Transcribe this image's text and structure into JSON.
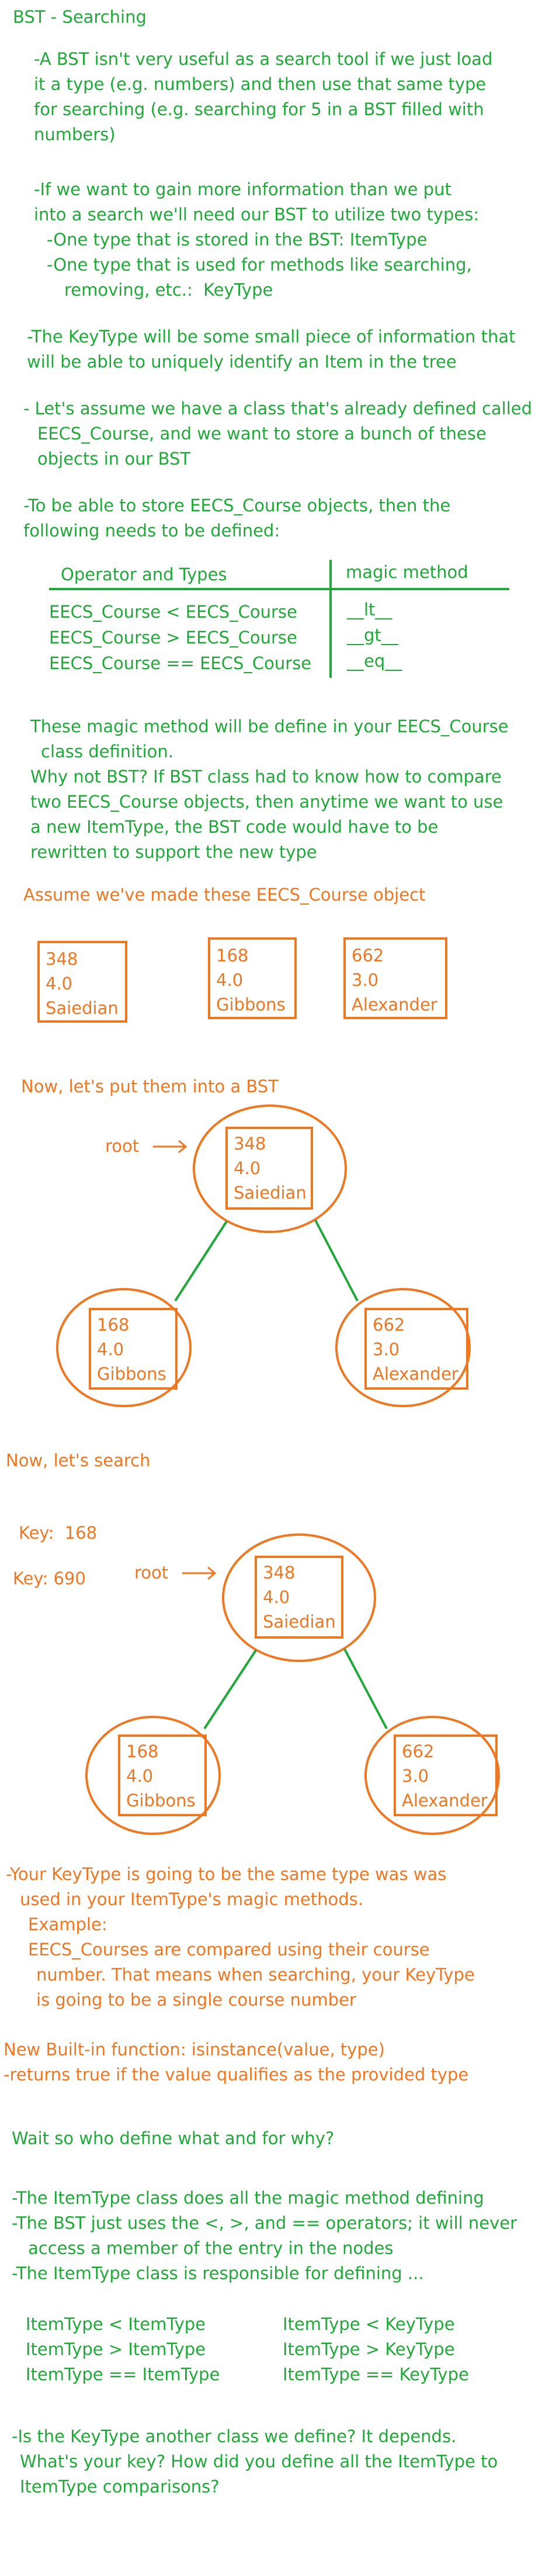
{
  "title": "BST - Searching",
  "intro": {
    "p1": [
      "-A BST isn't very useful as a search tool if we just load",
      "it a type (e.g. numbers) and then use that same type",
      "for searching (e.g. searching for 5 in a BST filled with",
      "numbers)"
    ],
    "p2": [
      "-If we want to gain more information than we put",
      "into a search we'll need our BST to utilize two types:",
      "-One type that is stored in the BST: ItemType",
      "-One type that is used for methods like searching,",
      "removing, etc.:  KeyType"
    ],
    "p3": [
      "-The KeyType will be some small piece of information that",
      "will be able to uniquely identify an Item in the tree"
    ],
    "p4": [
      "- Let's assume we have a class that's already defined called",
      "EECS_Course, and we want to store a bunch of these",
      "objects in our BST"
    ],
    "p5": [
      "-To be able to store EECS_Course objects, then the",
      "following needs to be defined:"
    ]
  },
  "table": {
    "header_left": "Operator and Types",
    "header_right": "magic method",
    "rows": [
      {
        "op": "EECS_Course < EECS_Course",
        "magic": "__lt__"
      },
      {
        "op": "EECS_Course > EECS_Course",
        "magic": "__gt__"
      },
      {
        "op": "EECS_Course == EECS_Course",
        "magic": "__eq__"
      }
    ]
  },
  "magic_note": [
    "These magic method will be define in your EECS_Course",
    "class definition.",
    "Why not BST? If BST class had to know how to compare",
    "two EECS_Course objects, then anytime we want to use",
    "a new ItemType, the BST code would have to be",
    "rewritten to support the new type"
  ],
  "objects_heading": "Assume we've made these EECS_Course object",
  "courses": [
    {
      "number": "348",
      "rating": "4.0",
      "name": "Saiedian"
    },
    {
      "number": "168",
      "rating": "4.0",
      "name": "Gibbons"
    },
    {
      "number": "662",
      "rating": "3.0",
      "name": "Alexander"
    }
  ],
  "bst_heading": "Now, let's put them into a BST",
  "root_label": "root",
  "search_heading": "Now, let's search",
  "keys": [
    "Key:  168",
    "Key: 690"
  ],
  "keytype_note": [
    "-Your KeyType is going to be the same type was was",
    "used in your ItemType's magic methods.",
    "Example:",
    "EECS_Courses are compared using their course",
    "number. That means when searching, your KeyType",
    "is going to be a single course number"
  ],
  "isinstance_note": [
    "New Built-in function: isinstance(value, type)",
    "-returns true if the value qualifies as the provided type"
  ],
  "who_defines": "Wait so who define what and for why?",
  "who_notes": [
    "-The ItemType class does all the magic method defining",
    "-The BST just uses the <, >, and == operators; it will never",
    "access a member of the entry in the nodes",
    "-The ItemType class is responsible for defining ..."
  ],
  "comparisons_left": [
    "ItemType < ItemType",
    "ItemType > ItemType",
    "ItemType == ItemType"
  ],
  "comparisons_right": [
    "ItemType < KeyType",
    "ItemType > KeyType",
    "ItemType == KeyType"
  ],
  "final_note": [
    "-Is the KeyType another class we define? It depends.",
    "What's your key? How did you define all the ItemType to",
    "ItemType comparisons?"
  ],
  "colors": {
    "green": "#21a83a",
    "orange": "#ee7722"
  }
}
